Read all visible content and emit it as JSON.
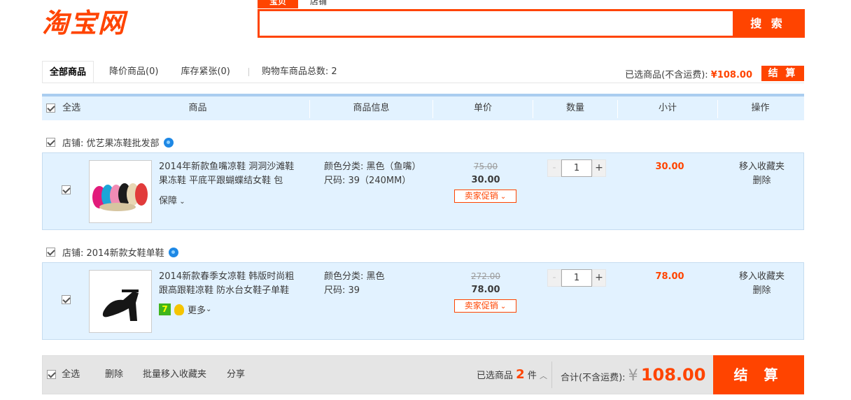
{
  "header": {
    "logo": "淘宝网",
    "search_tabs": [
      "宝贝",
      "店铺"
    ],
    "search_button": "搜 索",
    "search_placeholder": ""
  },
  "tabs": {
    "all": "全部商品",
    "price_drop": "降价商品(0)",
    "low_stock": "库存紧张(0)",
    "cart_total": "购物车商品总数: 2"
  },
  "summary": {
    "label": "已选商品(不含运费): ",
    "currency": "¥",
    "amount": "108.00",
    "checkout": "结 算"
  },
  "table_header": {
    "select_all": "全选",
    "product": "商品",
    "info": "商品信息",
    "unit_price": "单价",
    "quantity": "数量",
    "subtotal": "小计",
    "actions": "操作"
  },
  "shops": [
    {
      "name": "店铺: 优艺果冻鞋批发部",
      "item": {
        "title": "2014年新款鱼嘴凉鞋 洞洞沙滩鞋果冻鞋 平底平跟蝴蝶结女鞋 包",
        "sub": "保障",
        "attr_color": "颜色分类: 黑色（鱼嘴）",
        "attr_size": "尺码: 39（240MM）",
        "old_price": "75.00",
        "new_price": "30.00",
        "promo": "卖家促销",
        "quantity": "1",
        "subtotal": "30.00",
        "fav": "移入收藏夹",
        "delete": "删除"
      }
    },
    {
      "name": "店铺: 2014新款女鞋单鞋",
      "item": {
        "title": "2014新款春季女凉鞋 韩版时尚粗跟高跟鞋凉鞋 防水台女鞋子单鞋",
        "badge": "7",
        "sub": "更多",
        "attr_color": "颜色分类: 黑色",
        "attr_size": "尺码: 39",
        "old_price": "272.00",
        "new_price": "78.00",
        "promo": "卖家促销",
        "quantity": "1",
        "subtotal": "78.00",
        "fav": "移入收藏夹",
        "delete": "删除"
      }
    }
  ],
  "footer": {
    "select_all": "全选",
    "delete": "删除",
    "batch_fav": "批量移入收藏夹",
    "share": "分享",
    "selected_label": "已选商品",
    "selected_count": "2",
    "selected_unit": "件",
    "total_label": "合计(不含运费):",
    "currency": "¥",
    "total": "108.00",
    "checkout": "结 算"
  },
  "colors": {
    "brand": "#ff4400",
    "row_bg": "#e2f2ff",
    "header_border": "#aacdf0"
  }
}
